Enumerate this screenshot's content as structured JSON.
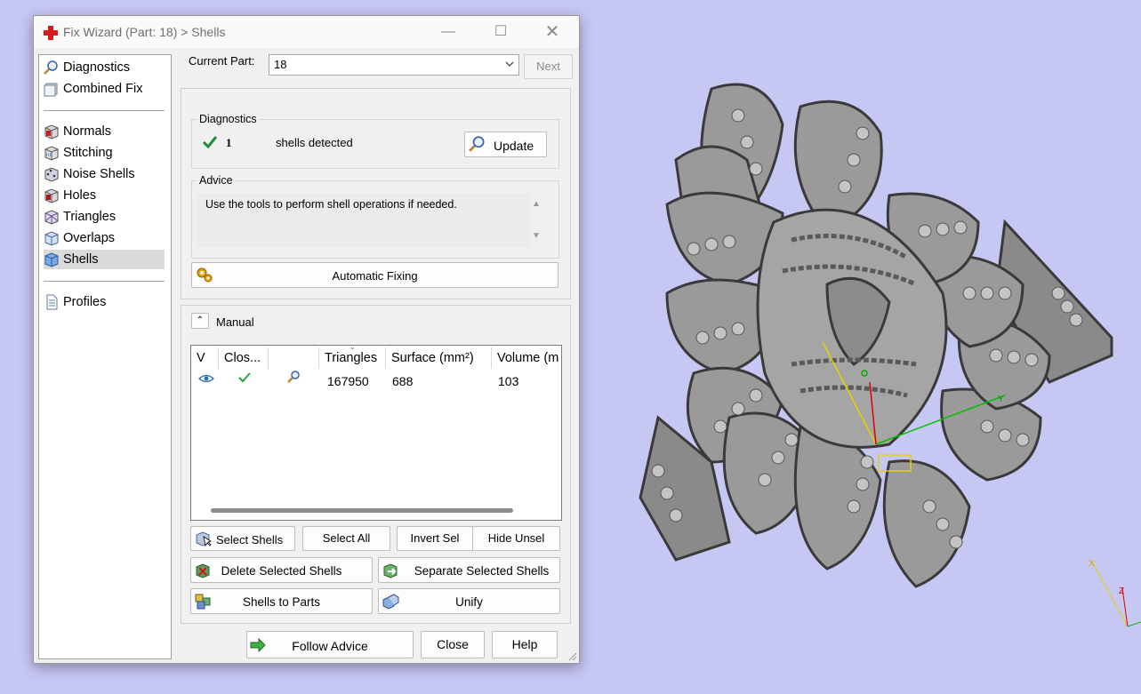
{
  "window": {
    "title": "Fix Wizard (Part: 18) > Shells"
  },
  "nav": {
    "items": [
      {
        "label": "Diagnostics",
        "icon": "magnifier-icon"
      },
      {
        "label": "Combined Fix",
        "icon": "combined-fix-icon"
      },
      {
        "label": "Normals",
        "icon": "normals-cube-icon"
      },
      {
        "label": "Stitching",
        "icon": "stitching-cube-icon"
      },
      {
        "label": "Noise Shells",
        "icon": "noise-shells-cube-icon"
      },
      {
        "label": "Holes",
        "icon": "holes-cube-icon"
      },
      {
        "label": "Triangles",
        "icon": "triangles-cube-icon"
      },
      {
        "label": "Overlaps",
        "icon": "overlaps-cube-icon"
      },
      {
        "label": "Shells",
        "icon": "shells-cube-icon",
        "selected": true
      },
      {
        "label": "Profiles",
        "icon": "profile-document-icon"
      }
    ]
  },
  "part": {
    "label": "Current Part:",
    "value": "18",
    "next_label": "Next"
  },
  "diagnostics": {
    "title": "Diagnostics",
    "count": "1",
    "status_text": "shells detected",
    "update_label": "Update"
  },
  "advice": {
    "title": "Advice",
    "text": "Use the tools to perform shell operations if needed."
  },
  "automatic_fixing_label": "Automatic Fixing",
  "manual": {
    "title": "Manual",
    "columns": [
      "V",
      "Clos...",
      "",
      "Triangles",
      "Surface (mm²)",
      "Volume (m"
    ],
    "rows": [
      {
        "triangles": "167950",
        "surface": "688",
        "volume": "103"
      }
    ]
  },
  "actions": {
    "select_shells": "Select Shells",
    "select_all": "Select All",
    "invert_sel": "Invert Sel",
    "hide_unsel": "Hide Unsel",
    "delete_selected_shells": "Delete Selected Shells",
    "separate_selected_shells": "Separate Selected Shells",
    "shells_to_parts": "Shells to Parts",
    "unify": "Unify"
  },
  "footer": {
    "follow_advice": "Follow Advice",
    "close": "Close",
    "help": "Help"
  },
  "viewport": {
    "axis_labels": [
      "X",
      "Y",
      "Z"
    ],
    "background": "#c7c7f4"
  }
}
